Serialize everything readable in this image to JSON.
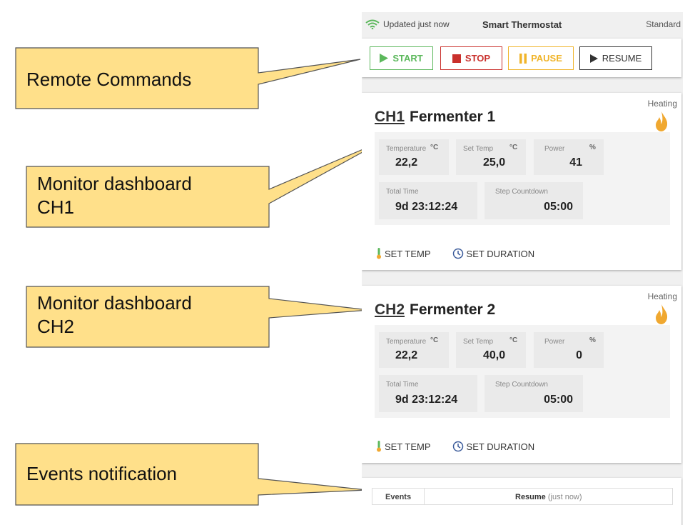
{
  "callouts": [
    {
      "text": "Remote Commands"
    },
    {
      "line1": "Monitor dashboard",
      "line2": "CH1"
    },
    {
      "line1": "Monitor dashboard",
      "line2": "CH2"
    },
    {
      "text": "Events notification"
    }
  ],
  "topbar": {
    "updated": "Updated just now",
    "title": "Smart Thermostat",
    "mode": "Standard"
  },
  "commands": {
    "start": "START",
    "stop": "STOP",
    "pause": "PAUSE",
    "resume": "RESUME"
  },
  "colors": {
    "start": "#5cb85c",
    "stop": "#c9302c",
    "pause": "#f0b429",
    "resume": "#333333",
    "flame": "#f0a830",
    "callout": "#ffe08a"
  },
  "channels": [
    {
      "status": "Heating",
      "ch": "CH1",
      "name": "Fermenter 1",
      "temperature": {
        "label": "Temperature",
        "unit": "°C",
        "value": "22,2"
      },
      "set_temp": {
        "label": "Set Temp",
        "unit": "°C",
        "value": "25,0"
      },
      "power": {
        "label": "Power",
        "unit": "%",
        "value": "41"
      },
      "total_time": {
        "label": "Total Time",
        "value": "9d 23:12:24"
      },
      "step_countdown": {
        "label": "Step Countdown",
        "value": "05:00"
      },
      "actions": {
        "set_temp": "SET TEMP",
        "set_duration": "SET DURATION"
      }
    },
    {
      "status": "Heating",
      "ch": "CH2",
      "name": "Fermenter 2",
      "temperature": {
        "label": "Temperature",
        "unit": "°C",
        "value": "22,2"
      },
      "set_temp": {
        "label": "Set Temp",
        "unit": "°C",
        "value": "40,0"
      },
      "power": {
        "label": "Power",
        "unit": "%",
        "value": "0"
      },
      "total_time": {
        "label": "Total Time",
        "value": "9d 23:12:24"
      },
      "step_countdown": {
        "label": "Step Countdown",
        "value": "05:00"
      },
      "actions": {
        "set_temp": "SET TEMP",
        "set_duration": "SET DURATION"
      }
    }
  ],
  "events": {
    "label": "Events",
    "last_event": "Resume",
    "time": "(just now)"
  }
}
